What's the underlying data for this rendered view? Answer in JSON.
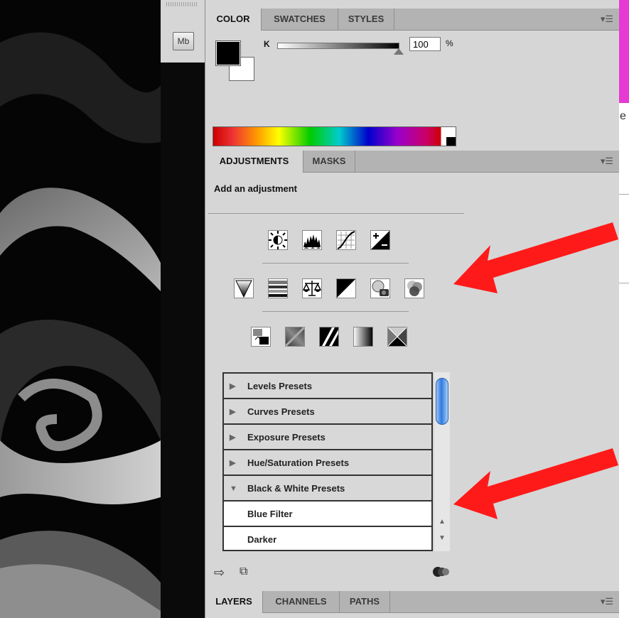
{
  "dock": {
    "mb_label": "Mb"
  },
  "color_panel": {
    "tabs": [
      "COLOR",
      "SWATCHES",
      "STYLES"
    ],
    "active_tab": "COLOR",
    "channel_label": "K",
    "value": "100",
    "unit": "%",
    "foreground": "#000000",
    "background": "#ffffff"
  },
  "adjustments_panel": {
    "tabs": [
      "ADJUSTMENTS",
      "MASKS"
    ],
    "active_tab": "ADJUSTMENTS",
    "heading": "Add an adjustment",
    "icons_row1": [
      "brightness-contrast-icon",
      "levels-icon",
      "curves-icon",
      "exposure-icon"
    ],
    "icons_row2": [
      "vibrance-icon",
      "hue-saturation-icon",
      "color-balance-icon",
      "black-white-icon",
      "photo-filter-icon",
      "channel-mixer-icon"
    ],
    "icons_row3": [
      "invert-icon",
      "posterize-icon",
      "threshold-icon",
      "gradient-map-icon",
      "selective-color-icon"
    ],
    "presets": [
      {
        "label": "Levels Presets",
        "type": "group",
        "expanded": false
      },
      {
        "label": "Curves Presets",
        "type": "group",
        "expanded": false
      },
      {
        "label": "Exposure Presets",
        "type": "group",
        "expanded": false
      },
      {
        "label": "Hue/Saturation Presets",
        "type": "group",
        "expanded": false
      },
      {
        "label": "Black & White Presets",
        "type": "group",
        "expanded": true
      },
      {
        "label": "Blue Filter",
        "type": "item"
      },
      {
        "label": "Darker",
        "type": "item"
      }
    ]
  },
  "layers_panel": {
    "tabs": [
      "LAYERS",
      "CHANNELS",
      "PATHS"
    ],
    "active_tab": "LAYERS"
  },
  "right_edge_text": "e",
  "colors": {
    "arrow": "#ff1a1a",
    "panel": "#d6d6d6",
    "tabbar": "#b3b3b3"
  }
}
